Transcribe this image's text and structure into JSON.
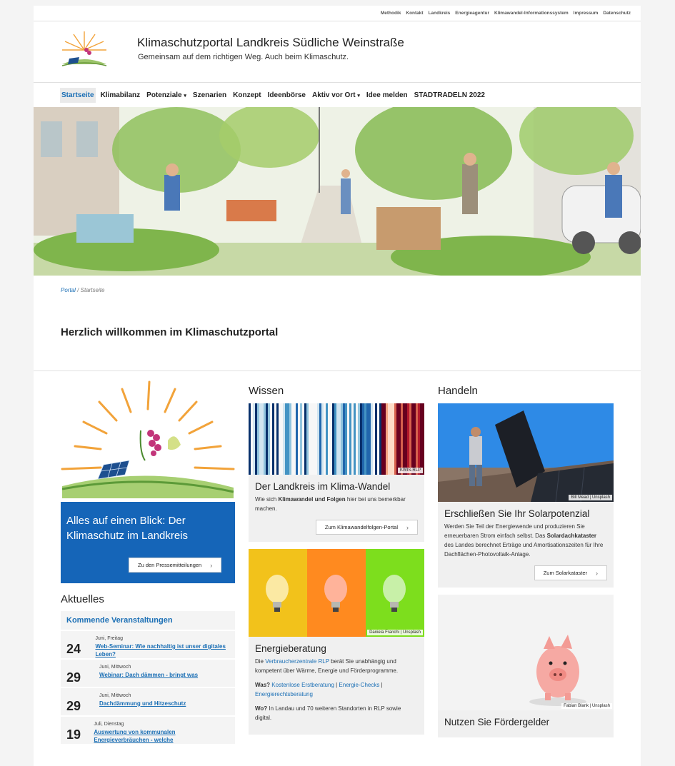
{
  "top_nav": [
    "Methodik",
    "Kontakt",
    "Landkreis",
    "Energieagentur",
    "Klimawandel-Informationssystem",
    "Impressum",
    "Datenschutz"
  ],
  "header": {
    "title": "Klimaschutzportal Landkreis Südliche Weinstraße",
    "subtitle": "Gemeinsam auf dem richtigen Weg. Auch beim Klimaschutz."
  },
  "main_nav": [
    {
      "label": "Startseite",
      "dropdown": false,
      "active": true
    },
    {
      "label": "Klimabilanz",
      "dropdown": false
    },
    {
      "label": "Potenziale",
      "dropdown": true
    },
    {
      "label": "Szenarien",
      "dropdown": false
    },
    {
      "label": "Konzept",
      "dropdown": false
    },
    {
      "label": "Ideenbörse",
      "dropdown": false
    },
    {
      "label": "Aktiv vor Ort",
      "dropdown": true
    },
    {
      "label": "Idee melden",
      "dropdown": false
    },
    {
      "label": "STADTRADELN 2022",
      "dropdown": false
    }
  ],
  "breadcrumb": {
    "root": "Portal",
    "separator": "/",
    "current": "Startseite"
  },
  "welcome": "Herzlich willkommen im Klimaschutzportal",
  "left": {
    "blue_box_title": "Alles auf einen Blick: Der Klimaschutz im Landkreis",
    "blue_box_button": "Zu den Pressemitteilungen",
    "aktuelles": "Aktuelles",
    "events_heading": "Kommende Veranstaltungen",
    "events": [
      {
        "day": "24",
        "meta": "Juni, Freitag",
        "title": "Web-Seminar: Wie nachhaltig ist unser digitales Leben?"
      },
      {
        "day": "29",
        "meta": "Juni, Mittwoch",
        "title": "Webinar: Dach dämmen - bringt was"
      },
      {
        "day": "29",
        "meta": "Juni, Mittwoch",
        "title": "Dachdämmung und Hitzeschutz"
      },
      {
        "day": "19",
        "meta": "Juli, Dienstag",
        "title": "Auswertung von kommunalen Energieverbräuchen - welche"
      }
    ]
  },
  "wissen": {
    "heading": "Wissen",
    "card1": {
      "credit": "KWIS-RLP",
      "title": "Der Landkreis im Klima-Wandel",
      "text_pre": "Wie sich ",
      "text_bold": "Klimawandel und Folgen",
      "text_post": " hier bei uns bemerkbar machen.",
      "button": "Zum Klimawandelfolgen-Portal"
    },
    "card2": {
      "credit": "Daniela Franchi | Unsplash",
      "title": "Energieberatung",
      "text_pre": "Die ",
      "text_link": "Verbraucherzentrale RLP",
      "text_post": " berät Sie unabhängig und kompetent über Wärme, Energie und Förderprogramme.",
      "was_label": "Was?",
      "was_links": [
        "Kostenlose Erstberatung",
        "Energie-Checks",
        "Energierechtsberatung"
      ],
      "link_sep": " | ",
      "wo_label": "Wo?",
      "wo_text": " In Landau und 70 weiteren Standorten in RLP sowie digital."
    }
  },
  "handeln": {
    "heading": "Handeln",
    "card1": {
      "credit": "Bill Mead | Unsplash",
      "title": "Erschließen Sie Ihr Solarpotenzial",
      "text_pre": "Werden Sie Teil der Energiewende und produzieren Sie erneuerbaren Strom einfach selbst. Das ",
      "text_bold": "Solardachkataster",
      "text_post": " des Landes berechnet Erträge und Amortisationszeiten für Ihre Dachflächen-Photovoltaik-Anlage.",
      "button": "Zum Solarkataster"
    },
    "card2": {
      "credit": "Fabian Blank | Unsplash",
      "title": "Nutzen Sie Fördergelder"
    }
  },
  "icons": [
    "chevron-right-icon",
    "caret-down-icon",
    "sun-logo",
    "solar-panel-icon",
    "lightbulb-icon",
    "piggy-bank-icon"
  ],
  "colors": {
    "accent": "#1b6fb5",
    "blue_box": "#1565b8",
    "card_bg": "#f0f0f0"
  }
}
